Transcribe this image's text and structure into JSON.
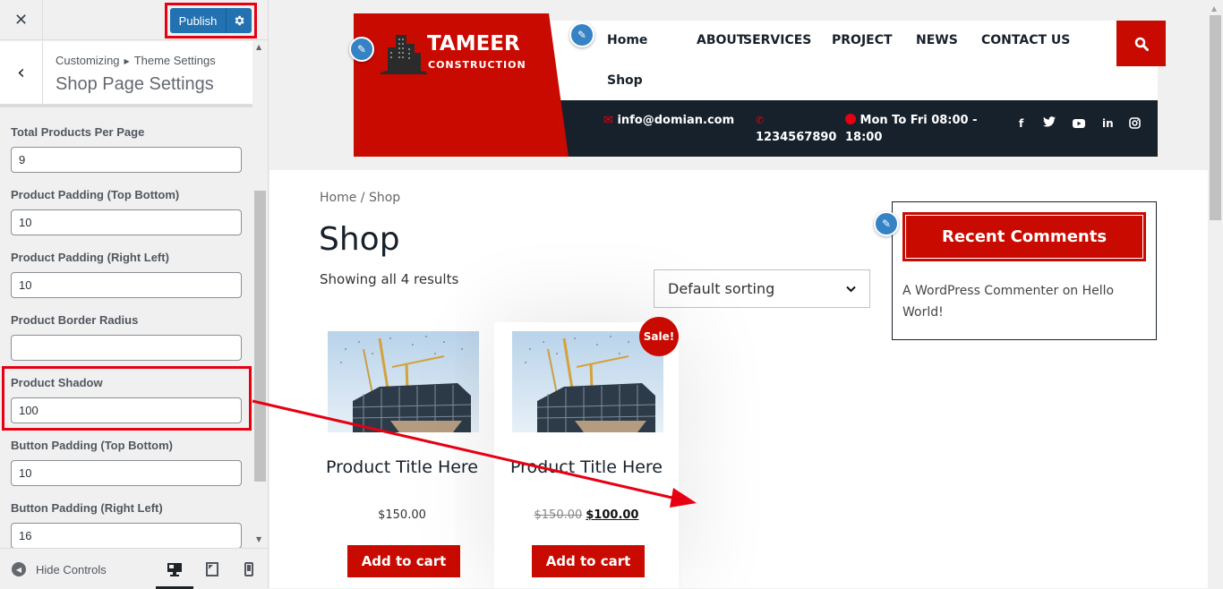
{
  "customizer": {
    "close_icon": "close-icon",
    "publish_label": "Publish",
    "publish_settings_icon": "gear-icon",
    "breadcrumb": {
      "root": "Customizing",
      "parent": "Theme Settings"
    },
    "section_title": "Shop Page Settings",
    "controls": [
      {
        "label": "Total Products Per Page",
        "value": "9"
      },
      {
        "label": "Product Padding (Top Bottom)",
        "value": "10"
      },
      {
        "label": "Product Padding (Right Left)",
        "value": "10"
      },
      {
        "label": "Product Border Radius",
        "value": ""
      },
      {
        "label": "Product Shadow",
        "value": "100"
      },
      {
        "label": "Button Padding (Top Bottom)",
        "value": "10"
      },
      {
        "label": "Button Padding (Right Left)",
        "value": "16"
      }
    ],
    "footer": {
      "hide_controls_label": "Hide Controls",
      "devices": [
        "desktop",
        "tablet",
        "mobile"
      ],
      "active_device": "desktop"
    }
  },
  "site": {
    "logo": {
      "name": "TAMEER",
      "tagline": "CONSTRUCTION"
    },
    "nav": [
      "Home",
      "ABOUT",
      "SERVICES",
      "PROJECT",
      "NEWS",
      "CONTACT US",
      "Shop"
    ],
    "contact": {
      "email": "info@domian.com",
      "phone": "1234567890",
      "hours_line1": "Mon To Fri 08:00 -",
      "hours_line2": "18:00"
    },
    "social": [
      "facebook",
      "twitter",
      "youtube",
      "linkedin",
      "instagram"
    ],
    "colors": {
      "brand_red": "#c90a00",
      "dark": "#17212b",
      "wp_blue": "#2271b1",
      "annotation_red": "#e60012"
    }
  },
  "shop": {
    "breadcrumb": "Home / Shop",
    "title": "Shop",
    "result_count": "Showing all 4 results",
    "sorting": "Default sorting",
    "products": [
      {
        "title": "Product Title Here",
        "price": "$150.00",
        "button": "Add to cart"
      },
      {
        "title": "Product Title Here",
        "old_price": "$150.00",
        "price": "$100.00",
        "badge": "Sale!",
        "button": "Add to cart"
      }
    ]
  },
  "widget": {
    "title": "Recent Comments",
    "author": "A WordPress Commenter",
    "connector": "on",
    "post": "Hello World!"
  }
}
